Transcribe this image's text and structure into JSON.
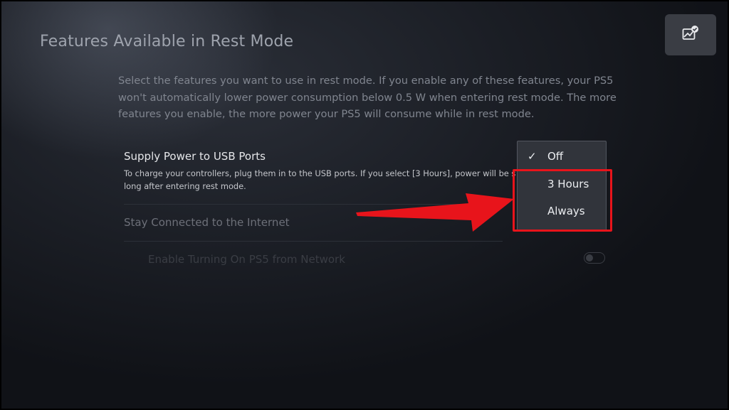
{
  "header": {
    "title": "Features Available in Rest Mode"
  },
  "capture_button": {
    "icon": "capture-gallery-icon"
  },
  "description": "Select the features you want to use in rest mode. If you enable any of these features, your PS5 won't automatically lower power consumption below 0.5 W when entering rest mode. The more features you enable, the more power your PS5 will consume while in rest mode.",
  "settings": {
    "usb": {
      "title": "Supply Power to USB Ports",
      "sub_line1": "To charge your controllers, plug them in to the USB ports. If you select [3 Hours], power will be s",
      "sub_line2": "long after entering rest mode."
    },
    "internet": {
      "title": "Stay Connected to the Internet"
    },
    "network": {
      "title": "Enable Turning On PS5 from Network",
      "toggle_state": "off"
    }
  },
  "dropdown": {
    "selected": "Off",
    "options": [
      {
        "label": "Off",
        "checked": true
      },
      {
        "label": "3 Hours",
        "checked": false
      },
      {
        "label": "Always",
        "checked": false
      }
    ]
  },
  "annotation": {
    "highlight_color": "#e8141b",
    "arrow_color": "#e8141b"
  },
  "colors": {
    "background": "#1b1e25",
    "menu_background": "#31343b",
    "accent_red": "#e8141b"
  }
}
